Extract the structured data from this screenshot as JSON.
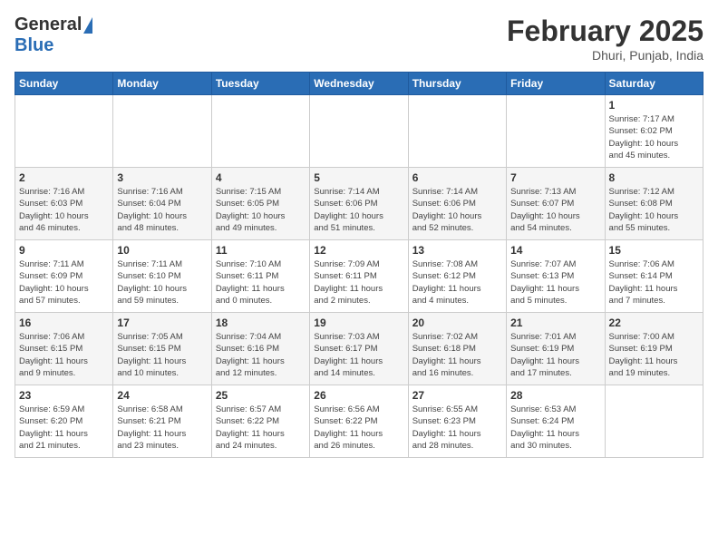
{
  "header": {
    "logo_general": "General",
    "logo_blue": "Blue",
    "month_title": "February 2025",
    "location": "Dhuri, Punjab, India"
  },
  "days_of_week": [
    "Sunday",
    "Monday",
    "Tuesday",
    "Wednesday",
    "Thursday",
    "Friday",
    "Saturday"
  ],
  "weeks": [
    [
      {
        "day": "",
        "info": ""
      },
      {
        "day": "",
        "info": ""
      },
      {
        "day": "",
        "info": ""
      },
      {
        "day": "",
        "info": ""
      },
      {
        "day": "",
        "info": ""
      },
      {
        "day": "",
        "info": ""
      },
      {
        "day": "1",
        "info": "Sunrise: 7:17 AM\nSunset: 6:02 PM\nDaylight: 10 hours\nand 45 minutes."
      }
    ],
    [
      {
        "day": "2",
        "info": "Sunrise: 7:16 AM\nSunset: 6:03 PM\nDaylight: 10 hours\nand 46 minutes."
      },
      {
        "day": "3",
        "info": "Sunrise: 7:16 AM\nSunset: 6:04 PM\nDaylight: 10 hours\nand 48 minutes."
      },
      {
        "day": "4",
        "info": "Sunrise: 7:15 AM\nSunset: 6:05 PM\nDaylight: 10 hours\nand 49 minutes."
      },
      {
        "day": "5",
        "info": "Sunrise: 7:14 AM\nSunset: 6:06 PM\nDaylight: 10 hours\nand 51 minutes."
      },
      {
        "day": "6",
        "info": "Sunrise: 7:14 AM\nSunset: 6:06 PM\nDaylight: 10 hours\nand 52 minutes."
      },
      {
        "day": "7",
        "info": "Sunrise: 7:13 AM\nSunset: 6:07 PM\nDaylight: 10 hours\nand 54 minutes."
      },
      {
        "day": "8",
        "info": "Sunrise: 7:12 AM\nSunset: 6:08 PM\nDaylight: 10 hours\nand 55 minutes."
      }
    ],
    [
      {
        "day": "9",
        "info": "Sunrise: 7:11 AM\nSunset: 6:09 PM\nDaylight: 10 hours\nand 57 minutes."
      },
      {
        "day": "10",
        "info": "Sunrise: 7:11 AM\nSunset: 6:10 PM\nDaylight: 10 hours\nand 59 minutes."
      },
      {
        "day": "11",
        "info": "Sunrise: 7:10 AM\nSunset: 6:11 PM\nDaylight: 11 hours\nand 0 minutes."
      },
      {
        "day": "12",
        "info": "Sunrise: 7:09 AM\nSunset: 6:11 PM\nDaylight: 11 hours\nand 2 minutes."
      },
      {
        "day": "13",
        "info": "Sunrise: 7:08 AM\nSunset: 6:12 PM\nDaylight: 11 hours\nand 4 minutes."
      },
      {
        "day": "14",
        "info": "Sunrise: 7:07 AM\nSunset: 6:13 PM\nDaylight: 11 hours\nand 5 minutes."
      },
      {
        "day": "15",
        "info": "Sunrise: 7:06 AM\nSunset: 6:14 PM\nDaylight: 11 hours\nand 7 minutes."
      }
    ],
    [
      {
        "day": "16",
        "info": "Sunrise: 7:06 AM\nSunset: 6:15 PM\nDaylight: 11 hours\nand 9 minutes."
      },
      {
        "day": "17",
        "info": "Sunrise: 7:05 AM\nSunset: 6:15 PM\nDaylight: 11 hours\nand 10 minutes."
      },
      {
        "day": "18",
        "info": "Sunrise: 7:04 AM\nSunset: 6:16 PM\nDaylight: 11 hours\nand 12 minutes."
      },
      {
        "day": "19",
        "info": "Sunrise: 7:03 AM\nSunset: 6:17 PM\nDaylight: 11 hours\nand 14 minutes."
      },
      {
        "day": "20",
        "info": "Sunrise: 7:02 AM\nSunset: 6:18 PM\nDaylight: 11 hours\nand 16 minutes."
      },
      {
        "day": "21",
        "info": "Sunrise: 7:01 AM\nSunset: 6:19 PM\nDaylight: 11 hours\nand 17 minutes."
      },
      {
        "day": "22",
        "info": "Sunrise: 7:00 AM\nSunset: 6:19 PM\nDaylight: 11 hours\nand 19 minutes."
      }
    ],
    [
      {
        "day": "23",
        "info": "Sunrise: 6:59 AM\nSunset: 6:20 PM\nDaylight: 11 hours\nand 21 minutes."
      },
      {
        "day": "24",
        "info": "Sunrise: 6:58 AM\nSunset: 6:21 PM\nDaylight: 11 hours\nand 23 minutes."
      },
      {
        "day": "25",
        "info": "Sunrise: 6:57 AM\nSunset: 6:22 PM\nDaylight: 11 hours\nand 24 minutes."
      },
      {
        "day": "26",
        "info": "Sunrise: 6:56 AM\nSunset: 6:22 PM\nDaylight: 11 hours\nand 26 minutes."
      },
      {
        "day": "27",
        "info": "Sunrise: 6:55 AM\nSunset: 6:23 PM\nDaylight: 11 hours\nand 28 minutes."
      },
      {
        "day": "28",
        "info": "Sunrise: 6:53 AM\nSunset: 6:24 PM\nDaylight: 11 hours\nand 30 minutes."
      },
      {
        "day": "",
        "info": ""
      }
    ]
  ]
}
